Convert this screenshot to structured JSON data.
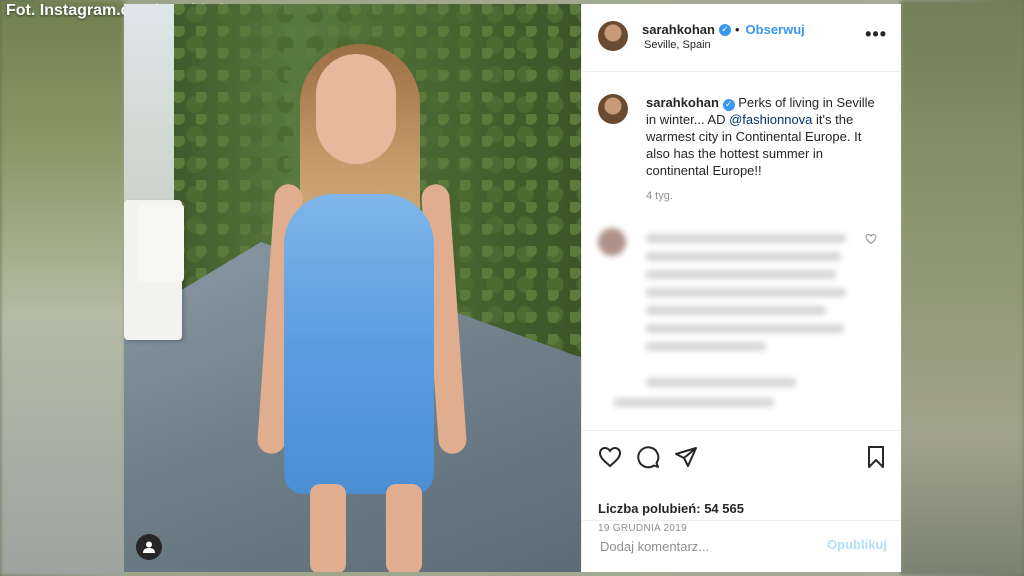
{
  "watermark": "Fot. Instagram.com/sarahkohan",
  "header": {
    "username": "sarahkohan",
    "separator": "•",
    "follow_label": "Obserwuj",
    "location": "Seville, Spain",
    "more_label": "•••"
  },
  "caption": {
    "username": "sarahkohan",
    "text_before": "Perks of living in Seville in winter... AD ",
    "mention": "@fashionnova",
    "text_after": " it's the warmest city in Continental Europe. It also has the hottest summer in continental Europe!!",
    "time_ago": "4 tyg."
  },
  "actions": {
    "icons": [
      "heart-icon",
      "comment-icon",
      "share-icon",
      "bookmark-icon"
    ],
    "likes_label": "Liczba polubień:",
    "likes_count": "54 565",
    "date": "19 GRUDNIA 2019"
  },
  "add_comment": {
    "placeholder": "Dodaj komentarz...",
    "post_label": "Opublikuj"
  },
  "colors": {
    "accent": "#3897f0",
    "post_disabled": "#b2dffc",
    "dress": "#5a9ddf"
  }
}
